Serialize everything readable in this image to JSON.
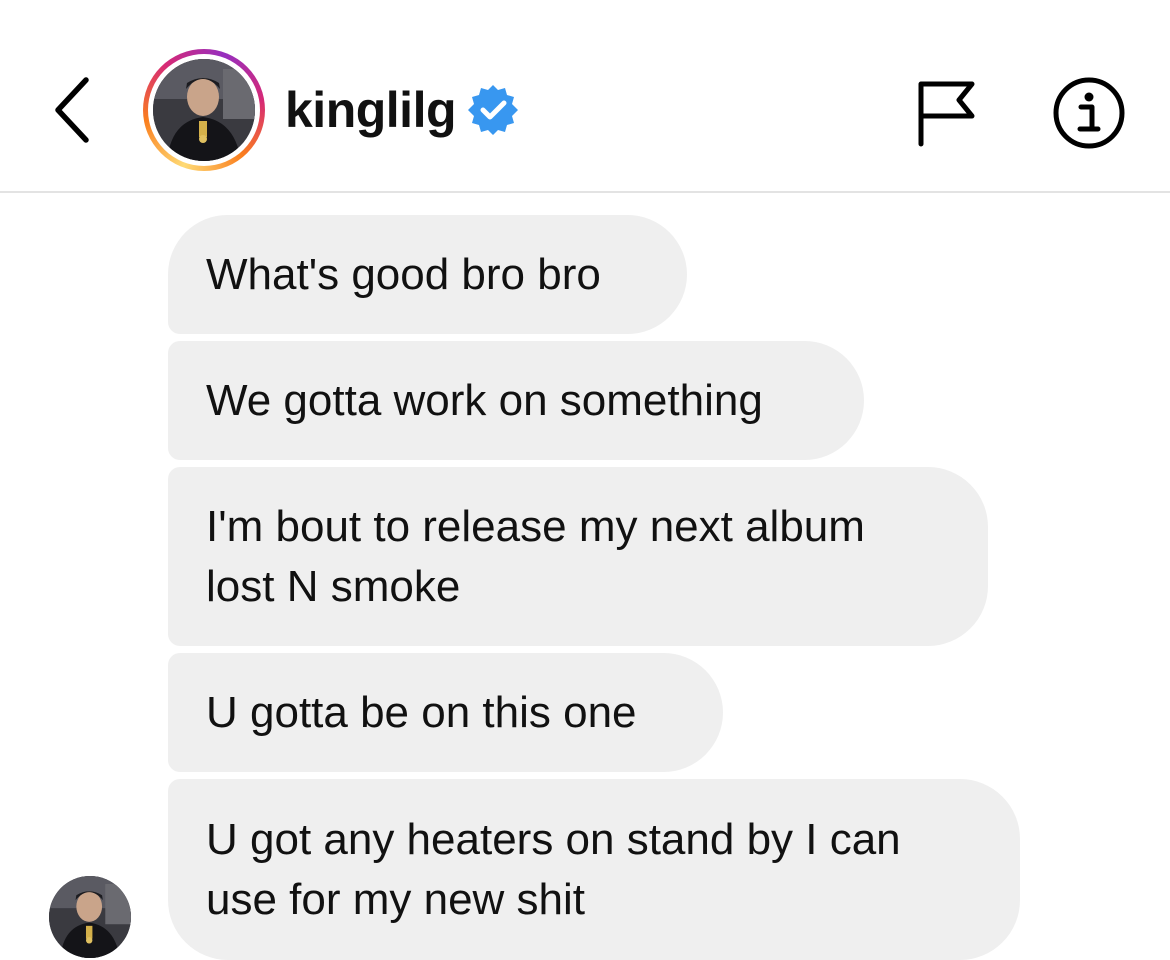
{
  "header": {
    "username": "kinglilg",
    "verified": true,
    "icons": {
      "back": "chevron-left-icon",
      "flag": "flag-icon",
      "info": "info-icon",
      "verified": "verified-badge-icon"
    }
  },
  "thread": {
    "messages": [
      {
        "text": "What's good bro bro"
      },
      {
        "text": "We gotta work on something"
      },
      {
        "text": "I'm bout to release my next album\nlost N smoke"
      },
      {
        "text": "U gotta be on this one"
      },
      {
        "text": "U got any heaters on stand by I can\nuse for my new shit"
      }
    ]
  },
  "colors": {
    "bubble": "#efefef",
    "verified_blue": "#3897f0",
    "divider": "#e3e3e3"
  }
}
